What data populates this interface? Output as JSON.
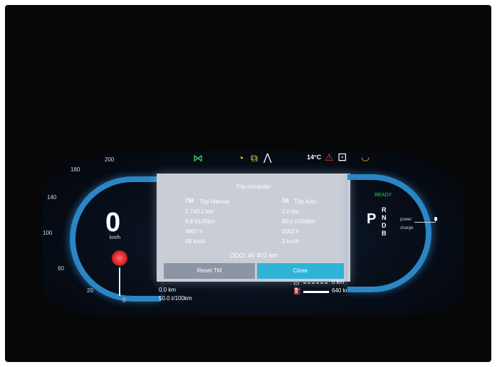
{
  "speedometer": {
    "speed": "0",
    "unit": "km/h",
    "ticks": [
      "200",
      "180",
      "140",
      "100",
      "60",
      "20",
      "0"
    ]
  },
  "top_bar": {
    "temperature": "14°C",
    "icons": [
      "lane-assist-icon",
      "wiper-fluid-icon",
      "low-beam-icon",
      "road-warning-icon",
      "seatbelt-warning-icon",
      "car-doors-icon",
      "tire-pressure-icon"
    ]
  },
  "trip_computer": {
    "title": "Trip computer",
    "manual": {
      "code": "TM",
      "label": "Trip Manual",
      "distance": "2 743.2 km",
      "consumption": "6.8 ℓ/100km",
      "time": "4867 h",
      "speed": "59 km/h"
    },
    "auto": {
      "code": "TA",
      "label": "Trip Auto",
      "distance": "0.0 km",
      "consumption": "80.0 ℓ/100km",
      "time": "0002 h",
      "speed": "3 km/h"
    },
    "odo_label": "ODO:",
    "odo_value": "46 402 km",
    "reset_label": "Reset TM",
    "close_label": "Close"
  },
  "bottom_left": {
    "distance": "0.0 km",
    "consumption": "50.0 ℓ/100km"
  },
  "bottom_right": {
    "electric_range": "0 km",
    "fuel_range": "640 km"
  },
  "right_gauge": {
    "ready": "READY",
    "selected_gear": "P",
    "gears": [
      "R",
      "N",
      "D",
      "B"
    ],
    "power_label": "power",
    "charge_label": "charge"
  },
  "colors": {
    "accent_blue": "#2a86c4",
    "close_button": "#2fb4d8",
    "ready_green": "#28d65a",
    "warning_red": "#e23a2a",
    "warning_amber": "#f2a51c"
  }
}
